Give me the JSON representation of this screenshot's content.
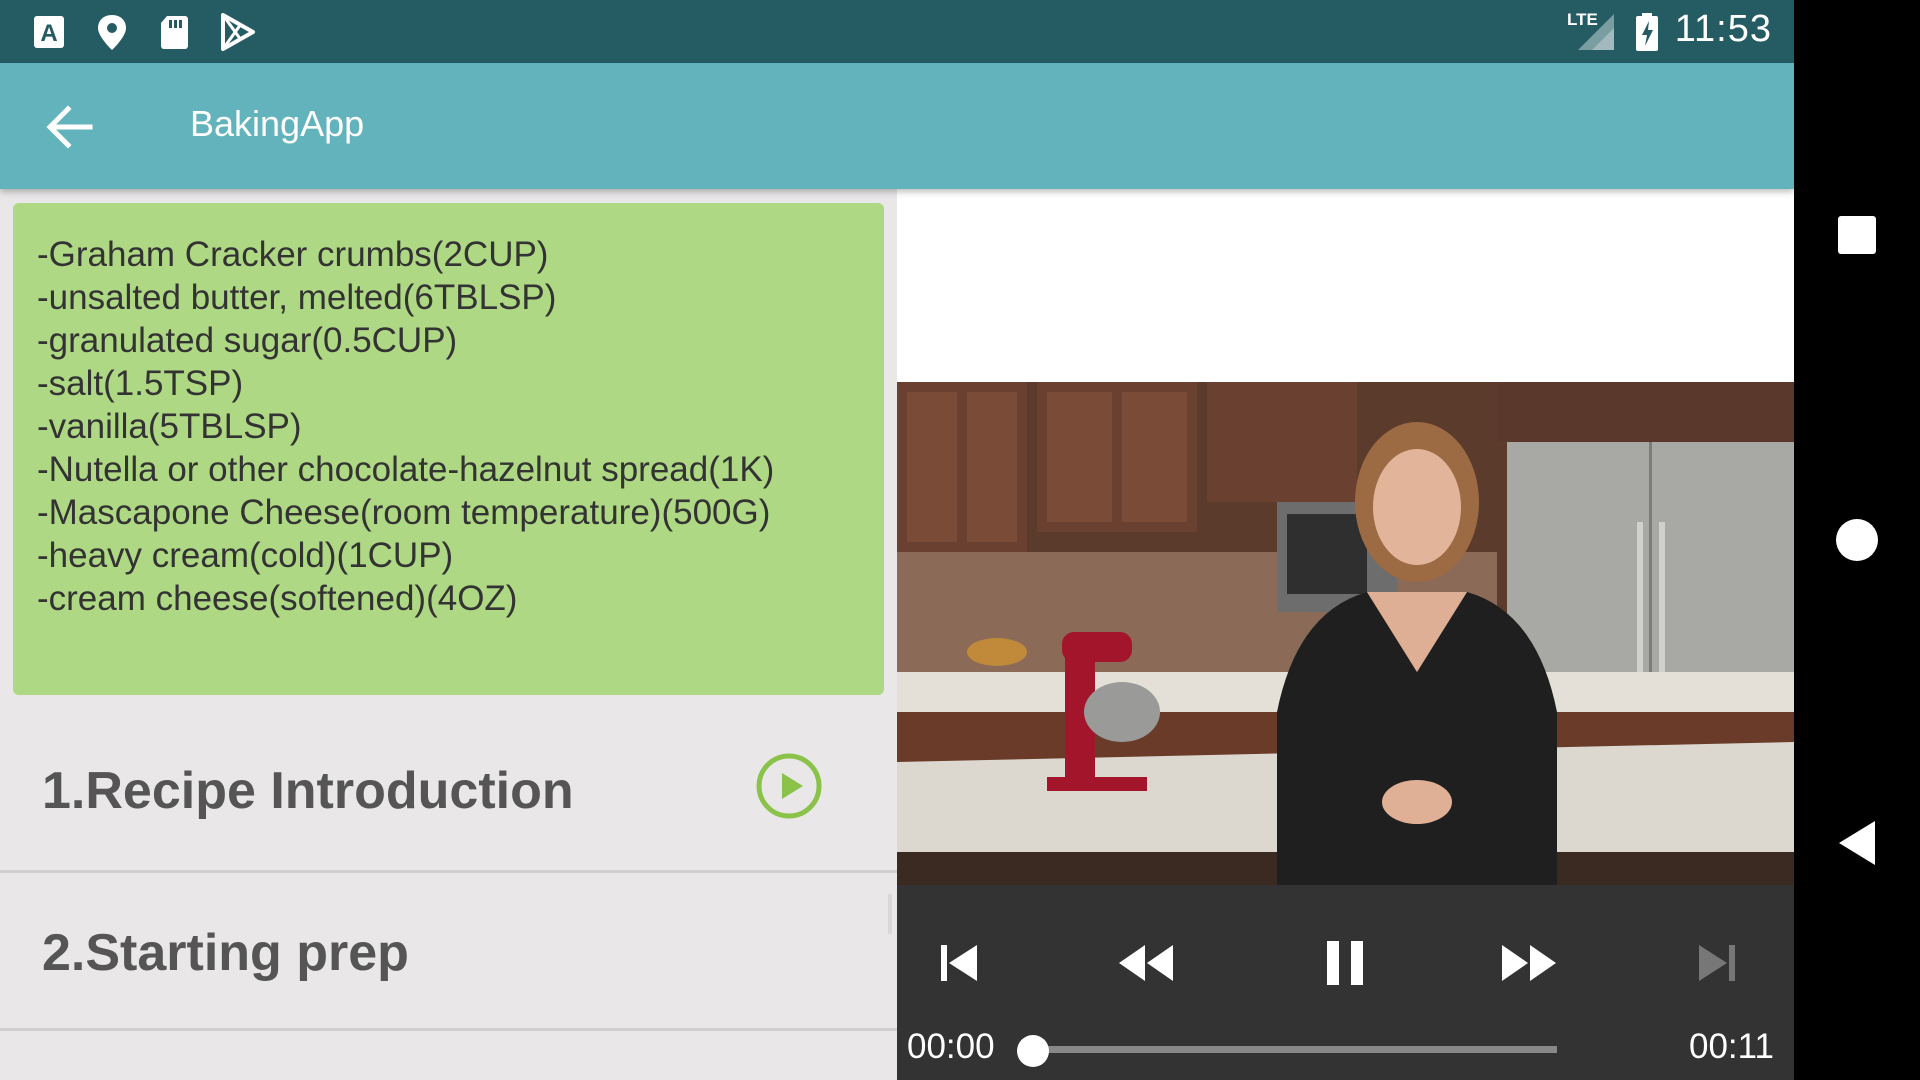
{
  "status_bar": {
    "time": "11:53",
    "network": "LTE",
    "icons": [
      "font-a-icon",
      "location-pin-icon",
      "sd-card-icon",
      "play-store-icon",
      "signal-icon",
      "battery-charging-icon"
    ]
  },
  "app_bar": {
    "title": "BakingApp"
  },
  "ingredients": [
    "-Graham Cracker crumbs(2CUP)",
    "-unsalted butter, melted(6TBLSP)",
    "-granulated sugar(0.5CUP)",
    "-salt(1.5TSP)",
    "-vanilla(5TBLSP)",
    "-Nutella or other chocolate-hazelnut spread(1K)",
    "-Mascapone Cheese(room temperature)(500G)",
    "-heavy cream(cold)(1CUP)",
    "-cream cheese(softened)(4OZ)"
  ],
  "steps": [
    {
      "label": "1.Recipe Introduction",
      "playing": true
    },
    {
      "label": "2.Starting prep",
      "playing": false
    }
  ],
  "player": {
    "current_time": "00:00",
    "duration": "00:11",
    "progress": 0.0,
    "state": "playing"
  },
  "colors": {
    "status_bar": "#255c64",
    "app_bar": "#63b3bd",
    "ingredients_card": "#afd884",
    "play_icon": "#8bc34a",
    "controls_bg": "#333333"
  }
}
